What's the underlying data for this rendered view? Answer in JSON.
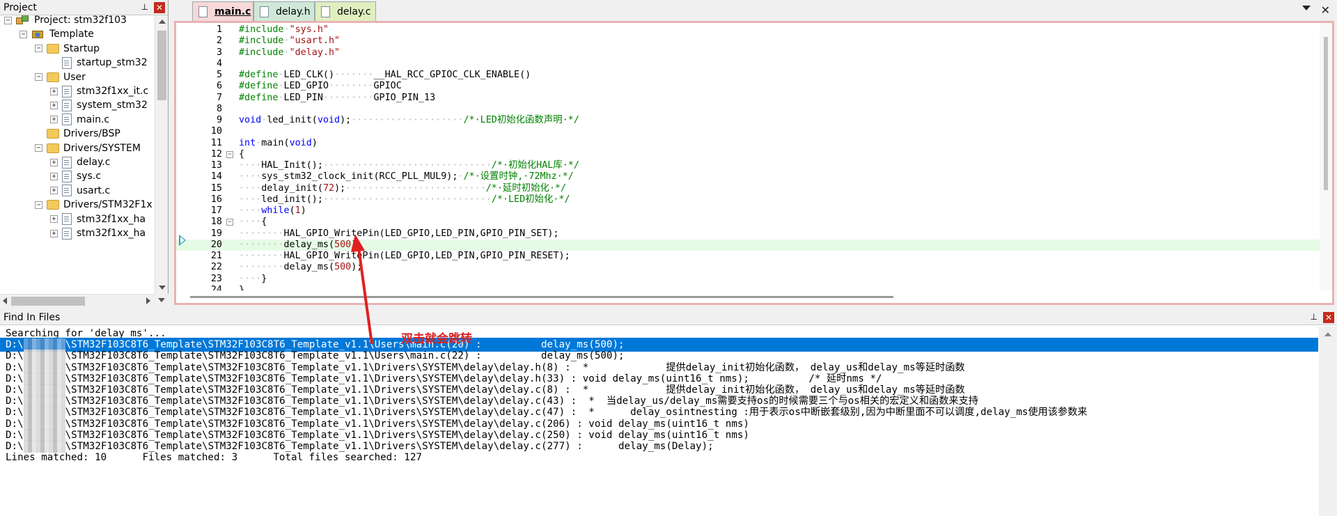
{
  "project_panel": {
    "title": "Project",
    "pin": "⊥",
    "close": "✕",
    "tree": [
      {
        "label": "Project: stm32f103",
        "icon": "project-icon"
      },
      {
        "label": "Template",
        "icon": "target-icon"
      },
      {
        "label": "Startup",
        "icon": "folder-icon"
      },
      {
        "label": "startup_stm32",
        "icon": "file-icon"
      },
      {
        "label": "User",
        "icon": "folder-icon"
      },
      {
        "label": "stm32f1xx_it.c",
        "icon": "file-icon"
      },
      {
        "label": "system_stm32",
        "icon": "file-icon"
      },
      {
        "label": "main.c",
        "icon": "file-icon"
      },
      {
        "label": "Drivers/BSP",
        "icon": "folder-icon"
      },
      {
        "label": "Drivers/SYSTEM",
        "icon": "folder-icon"
      },
      {
        "label": "delay.c",
        "icon": "file-icon"
      },
      {
        "label": "sys.c",
        "icon": "file-icon"
      },
      {
        "label": "usart.c",
        "icon": "file-icon"
      },
      {
        "label": "Drivers/STM32F1x",
        "icon": "folder-icon"
      },
      {
        "label": "stm32f1xx_ha",
        "icon": "file-icon"
      },
      {
        "label": "stm32f1xx_ha",
        "icon": "file-icon"
      }
    ]
  },
  "editor": {
    "tabs": [
      {
        "label": "main.c",
        "active": true
      },
      {
        "label": "delay.h",
        "active": false
      },
      {
        "label": "delay.c",
        "active": false
      }
    ],
    "tab_menu": "▼",
    "tab_close": "✕",
    "lines": [
      {
        "n": "1",
        "html": "<span class='pp'>#include</span><span class='dt'>·</span><span class='str'>\"sys.h\"</span>"
      },
      {
        "n": "2",
        "html": "<span class='pp'>#include</span><span class='dt'>·</span><span class='str'>\"usart.h\"</span>"
      },
      {
        "n": "3",
        "html": "<span class='pp'>#include</span><span class='dt'>·</span><span class='str'>\"delay.h\"</span>"
      },
      {
        "n": "4",
        "html": ""
      },
      {
        "n": "5",
        "html": "<span class='pp'>#define</span><span class='dt'>·</span>LED_CLK()<span class='dt'>·······</span>__HAL_RCC_GPIOC_CLK_ENABLE()"
      },
      {
        "n": "6",
        "html": "<span class='pp'>#define</span><span class='dt'>·</span>LED_GPIO<span class='dt'>········</span>GPIOC"
      },
      {
        "n": "7",
        "html": "<span class='pp'>#define</span><span class='dt'>·</span>LED_PIN<span class='dt'>·········</span>GPIO_PIN_13"
      },
      {
        "n": "8",
        "html": ""
      },
      {
        "n": "9",
        "html": "<span class='kw'>void</span><span class='dt'>·</span>led_init(<span class='kw'>void</span>);<span class='dt'>····················</span><span class='cm'>/*·LED初始化函数声明·*/</span>"
      },
      {
        "n": "10",
        "html": ""
      },
      {
        "n": "11",
        "html": "<span class='kw'>int</span><span class='dt'>·</span>main(<span class='kw'>void</span>)"
      },
      {
        "n": "12",
        "html": "{",
        "fold": "−"
      },
      {
        "n": "13",
        "html": "<span class='dt'>····</span>HAL_Init();<span class='dt'>······························</span><span class='cm'>/*·初始化HAL库·*/</span>"
      },
      {
        "n": "14",
        "html": "<span class='dt'>····</span>sys_stm32_clock_init(RCC_PLL_MUL9);<span class='dt'>·</span><span class='cm'>/*·设置时钟,·72Mhz·*/</span>"
      },
      {
        "n": "15",
        "html": "<span class='dt'>····</span>delay_init(<span class='num'>72</span>);<span class='dt'>·························</span><span class='cm'>/*·延时初始化·*/</span>"
      },
      {
        "n": "16",
        "html": "<span class='dt'>····</span>led_init();<span class='dt'>······························</span><span class='cm'>/*·LED初始化·*/</span>"
      },
      {
        "n": "17",
        "html": "<span class='dt'>····</span><span class='kw'>while</span>(<span class='num'>1</span>)"
      },
      {
        "n": "18",
        "html": "<span class='dt'>····</span>{",
        "fold": "−"
      },
      {
        "n": "19",
        "html": "<span class='dt'>········</span>HAL_GPIO_WritePin(LED_GPIO,LED_PIN,GPIO_PIN_SET);"
      },
      {
        "n": "20",
        "html": "<span class='dt'>········</span>delay_ms(<span class='num'>500</span>);",
        "hl": true
      },
      {
        "n": "21",
        "html": "<span class='dt'>········</span>HAL_GPIO_WritePin(LED_GPIO,LED_PIN,GPIO_PIN_RESET);"
      },
      {
        "n": "22",
        "html": "<span class='dt'>········</span>delay_ms(<span class='num'>500</span>);"
      },
      {
        "n": "23",
        "html": "<span class='dt'>····</span>}"
      },
      {
        "n": "24",
        "html": "}"
      }
    ]
  },
  "find_panel": {
    "title": "Find In Files",
    "pin": "⊥",
    "close": "✕",
    "searching": "Searching for 'delay_ms'...",
    "results": [
      {
        "prefix": "D:\\",
        "path": "\\STM32F103C8T6_Template\\STM32F103C8T6_Template_v1.1\\Users\\main.c(20) :          delay_ms(500);",
        "selected": true
      },
      {
        "prefix": "D:\\",
        "path": "\\STM32F103C8T6_Template\\STM32F103C8T6_Template_v1.1\\Users\\main.c(22) :          delay_ms(500);"
      },
      {
        "prefix": "D:\\",
        "path": "\\STM32F103C8T6_Template\\STM32F103C8T6_Template_v1.1\\Drivers\\SYSTEM\\delay\\delay.h(8) :  *             提供delay_init初始化函数， delay_us和delay_ms等延时函数"
      },
      {
        "prefix": "D:\\",
        "path": "\\STM32F103C8T6_Template\\STM32F103C8T6_Template_v1.1\\Drivers\\SYSTEM\\delay\\delay.h(33) : void delay_ms(uint16_t nms);          /* 延时nms */"
      },
      {
        "prefix": "D:\\",
        "path": "\\STM32F103C8T6_Template\\STM32F103C8T6_Template_v1.1\\Drivers\\SYSTEM\\delay\\delay.c(8) :  *             提供delay_init初始化函数， delay_us和delay_ms等延时函数"
      },
      {
        "prefix": "D:\\",
        "path": "\\STM32F103C8T6_Template\\STM32F103C8T6_Template_v1.1\\Drivers\\SYSTEM\\delay\\delay.c(43) :  *  当delay_us/delay_ms需要支持os的时候需要三个与os相关的宏定义和函数来支持"
      },
      {
        "prefix": "D:\\",
        "path": "\\STM32F103C8T6_Template\\STM32F103C8T6_Template_v1.1\\Drivers\\SYSTEM\\delay\\delay.c(47) :  *      delay_osintnesting :用于表示os中断嵌套级别,因为中断里面不可以调度,delay_ms使用该参数来"
      },
      {
        "prefix": "D:\\",
        "path": "\\STM32F103C8T6_Template\\STM32F103C8T6_Template_v1.1\\Drivers\\SYSTEM\\delay\\delay.c(206) : void delay_ms(uint16_t nms)"
      },
      {
        "prefix": "D:\\",
        "path": "\\STM32F103C8T6_Template\\STM32F103C8T6_Template_v1.1\\Drivers\\SYSTEM\\delay\\delay.c(250) : void delay_ms(uint16_t nms)"
      },
      {
        "prefix": "D:\\",
        "path": "\\STM32F103C8T6_Template\\STM32F103C8T6_Template_v1.1\\Drivers\\SYSTEM\\delay\\delay.c(277) :      delay_ms(Delay);"
      }
    ],
    "summary": "Lines matched: 10      Files matched: 3      Total files searched: 127"
  },
  "annotation": {
    "text": "双击就会跳转",
    "color": "#e02020"
  },
  "colors": {
    "selection": "#0078d7",
    "active_tab": "#f8d8d8",
    "current_line": "#e6fbe6"
  }
}
